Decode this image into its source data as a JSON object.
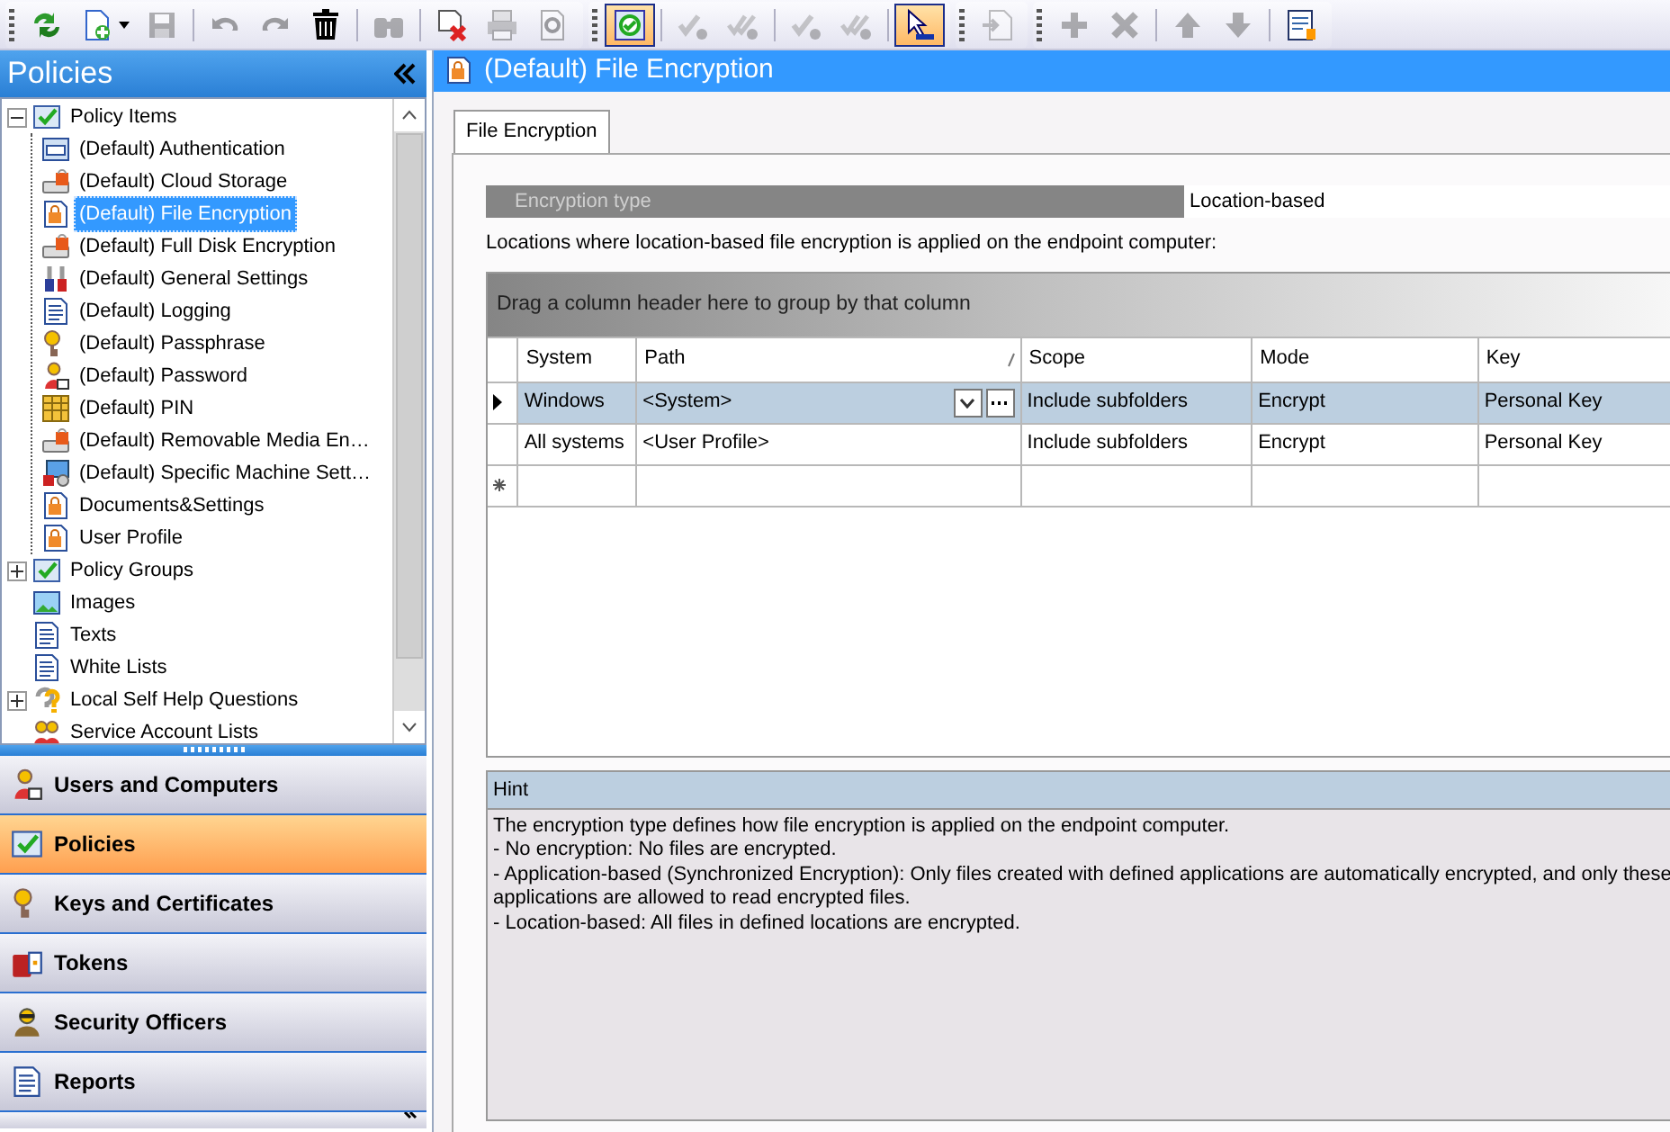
{
  "toolbar": [
    {
      "items": [
        {
          "kind": "refresh",
          "disabled": false,
          "pressed": false
        },
        {
          "kind": "new-document",
          "disabled": false,
          "pressed": false,
          "dropdown": true
        },
        {
          "kind": "save",
          "disabled": true,
          "pressed": false
        },
        {
          "kind": "separator"
        },
        {
          "kind": "undo",
          "disabled": true,
          "pressed": false
        },
        {
          "kind": "redo",
          "disabled": true,
          "pressed": false
        },
        {
          "kind": "trash",
          "disabled": false,
          "pressed": false
        },
        {
          "kind": "separator"
        },
        {
          "kind": "binoculars",
          "disabled": true,
          "pressed": false
        },
        {
          "kind": "separator"
        },
        {
          "kind": "delete-document",
          "disabled": false,
          "pressed": false
        },
        {
          "kind": "printer",
          "disabled": true,
          "pressed": false
        },
        {
          "kind": "preview",
          "disabled": true,
          "pressed": false
        }
      ]
    },
    {
      "items": [
        {
          "kind": "inspect",
          "disabled": false,
          "pressed": true
        },
        {
          "kind": "separator"
        },
        {
          "kind": "check",
          "disabled": true,
          "pressed": false
        },
        {
          "kind": "double-check",
          "disabled": true,
          "pressed": false
        },
        {
          "kind": "separator"
        },
        {
          "kind": "check",
          "disabled": true,
          "pressed": false
        },
        {
          "kind": "double-check",
          "disabled": true,
          "pressed": false
        },
        {
          "kind": "separator"
        },
        {
          "kind": "cursor",
          "disabled": false,
          "pressed": true
        }
      ]
    },
    {
      "items": [
        {
          "kind": "import",
          "disabled": true,
          "pressed": false
        }
      ]
    },
    {
      "items": [
        {
          "kind": "plus",
          "disabled": true,
          "pressed": false
        },
        {
          "kind": "cross",
          "disabled": true,
          "pressed": false
        },
        {
          "kind": "separator"
        },
        {
          "kind": "up-arrow",
          "disabled": true,
          "pressed": false
        },
        {
          "kind": "down-arrow",
          "disabled": true,
          "pressed": false
        },
        {
          "kind": "separator"
        },
        {
          "kind": "report",
          "disabled": false,
          "pressed": false
        }
      ]
    }
  ],
  "sidebar": {
    "title": "Policies",
    "tree": [
      {
        "label": "Policy Items",
        "kind": "checklist",
        "expanded": true,
        "selected": false,
        "children": [
          {
            "label": "(Default) Authentication",
            "kind": "window",
            "selected": false
          },
          {
            "label": "(Default) Cloud Storage",
            "kind": "drive-lock",
            "selected": false
          },
          {
            "label": "(Default) File Encryption",
            "kind": "lock-document",
            "selected": true
          },
          {
            "label": "(Default) Full Disk Encryption",
            "kind": "drive-lock",
            "selected": false
          },
          {
            "label": "(Default) General Settings",
            "kind": "tools",
            "selected": false
          },
          {
            "label": "(Default) Logging",
            "kind": "document",
            "selected": false
          },
          {
            "label": "(Default) Passphrase",
            "kind": "key",
            "selected": false
          },
          {
            "label": "(Default) Password",
            "kind": "person",
            "selected": false
          },
          {
            "label": "(Default) PIN",
            "kind": "keypad",
            "selected": false
          },
          {
            "label": "(Default) Removable Media En…",
            "kind": "drive-lock",
            "selected": false
          },
          {
            "label": "(Default) Specific Machine Sett…",
            "kind": "computer",
            "selected": false
          },
          {
            "label": "Documents&Settings",
            "kind": "lock-document",
            "selected": false
          },
          {
            "label": "User Profile",
            "kind": "lock-document",
            "selected": false
          }
        ]
      },
      {
        "label": "Policy Groups",
        "kind": "checklist",
        "expanded": false,
        "selected": false
      },
      {
        "label": "Images",
        "kind": "image",
        "selected": false
      },
      {
        "label": "Texts",
        "kind": "document",
        "selected": false
      },
      {
        "label": "White Lists",
        "kind": "document",
        "selected": false
      },
      {
        "label": "Local Self Help Questions",
        "kind": "question",
        "expanded": false,
        "selected": false
      },
      {
        "label": "Service Account Lists",
        "kind": "people",
        "selected": false
      }
    ]
  },
  "nav": [
    {
      "label": "Users and Computers",
      "kind": "person",
      "selected": false
    },
    {
      "label": "Policies",
      "kind": "checklist",
      "selected": true
    },
    {
      "label": "Keys and Certificates",
      "kind": "key",
      "selected": false
    },
    {
      "label": "Tokens",
      "kind": "token",
      "selected": false
    },
    {
      "label": "Security Officers",
      "kind": "officer",
      "selected": false
    },
    {
      "label": "Reports",
      "kind": "document",
      "selected": false
    }
  ],
  "content": {
    "title": "(Default) File Encryption",
    "tabs": [
      {
        "label": "File Encryption",
        "selected": true
      }
    ],
    "encryption_type": {
      "label": "Encryption type",
      "value": "Location-based"
    },
    "description": "Locations where location-based file encryption is applied on the endpoint computer:",
    "grid": {
      "group_hint": "Drag a column header here to group by that column",
      "columns": [
        {
          "label": "System",
          "editable": false
        },
        {
          "label": "Path",
          "editable": true
        },
        {
          "label": "Scope",
          "editable": false
        },
        {
          "label": "Mode",
          "editable": false
        },
        {
          "label": "Key",
          "editable": false
        }
      ],
      "rows": [
        {
          "kind": "data",
          "selected": true,
          "editing": true,
          "cells": [
            "Windows",
            "<System>",
            "Include subfolders",
            "Encrypt",
            "Personal Key"
          ]
        },
        {
          "kind": "data",
          "selected": false,
          "editing": false,
          "cells": [
            "All systems",
            "<User Profile>",
            "Include subfolders",
            "Encrypt",
            "Personal Key"
          ]
        },
        {
          "kind": "new",
          "selected": false,
          "cells": []
        }
      ]
    },
    "hint": {
      "title": "Hint",
      "lines": [
        "The encryption type defines how file encryption is applied on the endpoint computer.",
        "- No encryption: No files are encrypted.",
        "- Application-based (Synchronized Encryption): Only files created with defined applications are automatically encrypted, and only these applications are allowed to read encrypted files.",
        "- Location-based: All files in defined locations are encrypted."
      ]
    }
  }
}
